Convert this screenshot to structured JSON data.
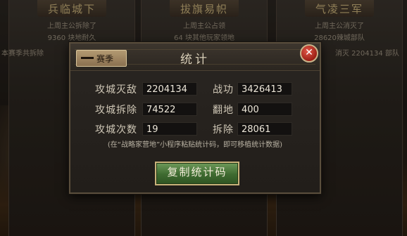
{
  "background": {
    "cards": [
      {
        "title": "兵临城下",
        "line1": "上周主公拆除了",
        "line2": "9360 块地耐久"
      },
      {
        "title": "拔旗易帜",
        "line1": "上周主公占领",
        "line2": "64 块其他玩家领地"
      },
      {
        "title": "气凌三军",
        "line1": "上周主公消灭了",
        "line2": "28620辣城部队"
      }
    ],
    "left_caption": "本赛季共拆除",
    "right_caption": "消灭 2204134 部队"
  },
  "dialog": {
    "season_tab": "赛季",
    "title": "统计",
    "stats": {
      "siege_kills": {
        "label": "攻城灭敌",
        "value": "2204134"
      },
      "merit": {
        "label": "战功",
        "value": "3426413"
      },
      "siege_demolish": {
        "label": "攻城拆除",
        "value": "74522"
      },
      "flip_land": {
        "label": "翻地",
        "value": "400"
      },
      "siege_count": {
        "label": "攻城次数",
        "value": "19"
      },
      "demolish": {
        "label": "拆除",
        "value": "28061"
      }
    },
    "hint": "(在“战略家营地”小程序粘贴统计码，即可移植统计数据)",
    "copy_button": "复制统计码"
  },
  "colors": {
    "accent_gold": "#c9b27a",
    "button_green": "#3e6a30",
    "close_red": "#9c1f15"
  }
}
